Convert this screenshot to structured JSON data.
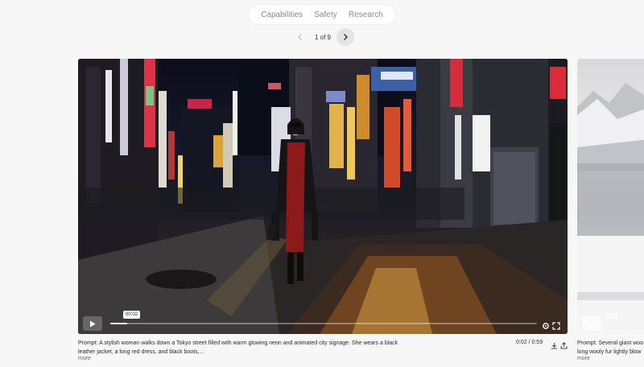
{
  "nav": {
    "tabs": [
      {
        "label": "Capabilities"
      },
      {
        "label": "Safety"
      },
      {
        "label": "Research"
      }
    ]
  },
  "pager": {
    "current": "1 of 9"
  },
  "video1": {
    "elapsed_tip": "00:02",
    "time": "0:02 / 0:59",
    "progress": 0.04,
    "prompt": "Prompt: A stylish woman walks down a Tokyo street filled with warm glowing neon and animated city signage. She wears a black leather jacket, a long red dress, and black boots,...",
    "more": "more"
  },
  "video2": {
    "prompt_line1": "Prompt: Several giant woo",
    "prompt_line2": "long wooly fur lightly blow",
    "more": "more"
  },
  "colors": {
    "accent": "#ffffff",
    "page_bg": "#f7f7f8",
    "pill_bg": "#ffffff"
  },
  "icons": [
    "chevron-left-icon",
    "chevron-right-icon",
    "play-icon",
    "settings-icon",
    "fullscreen-icon",
    "download-icon",
    "share-icon"
  ]
}
